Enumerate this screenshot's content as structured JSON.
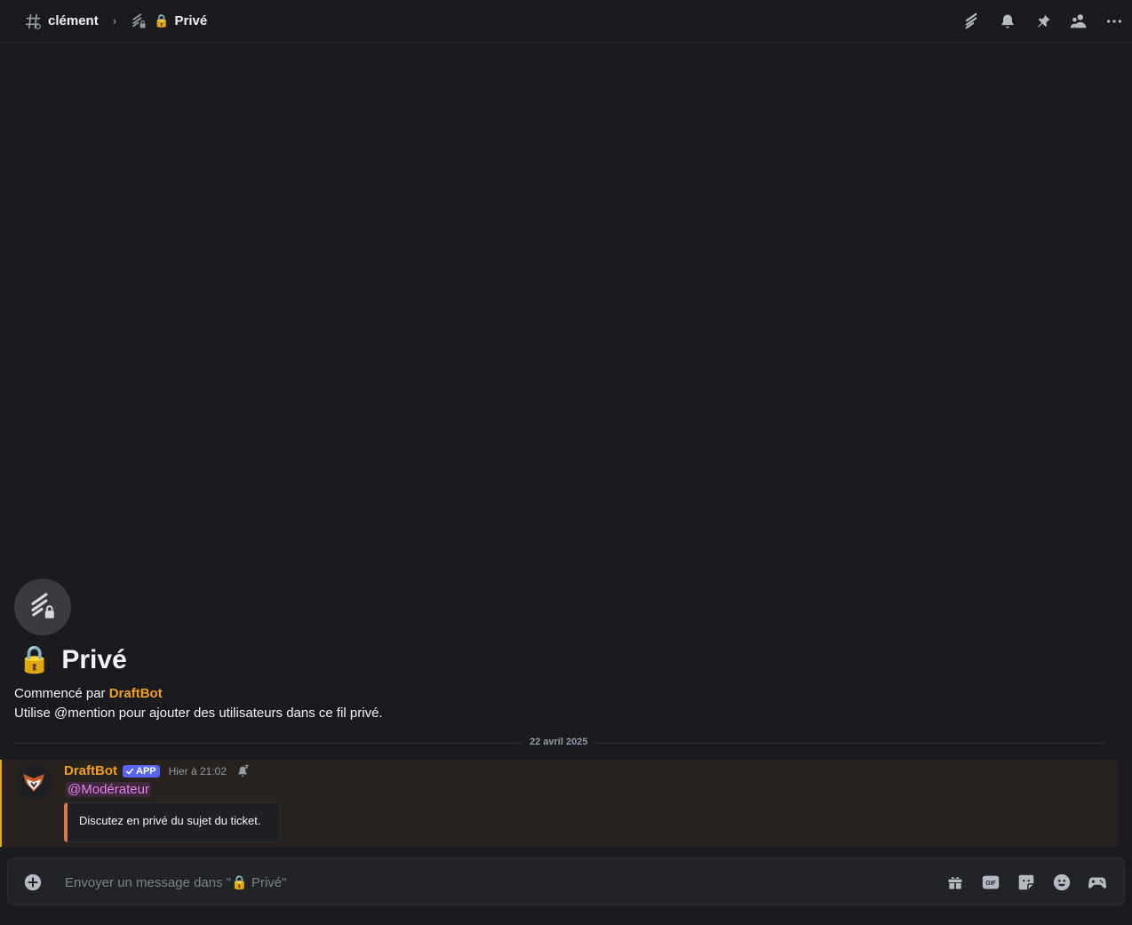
{
  "header": {
    "channel": "clément",
    "thread_lock": "🔒",
    "thread": "Privé",
    "breadcrumb_sep": "›"
  },
  "thread_start": {
    "lock": "🔒",
    "title": "Privé",
    "started_prefix": "Commencé par ",
    "started_by": "DraftBot",
    "hint": "Utilise @mention pour ajouter des utilisateurs dans ce fil privé."
  },
  "divider": {
    "date": "22 avril 2025"
  },
  "message": {
    "author": "DraftBot",
    "app_tag": "APP",
    "time": "Hier à 21:02",
    "mention": "@Modérateur",
    "embed_text": "Discutez en privé du sujet du ticket."
  },
  "composer": {
    "placeholder": "Envoyer un message dans \"🔒 Privé\""
  },
  "colors": {
    "background": "#1b1b1f",
    "author": "#f0a020",
    "mention": "#e07ff0",
    "app_tag": "#5865f2",
    "embed_border": "#d87a50"
  }
}
